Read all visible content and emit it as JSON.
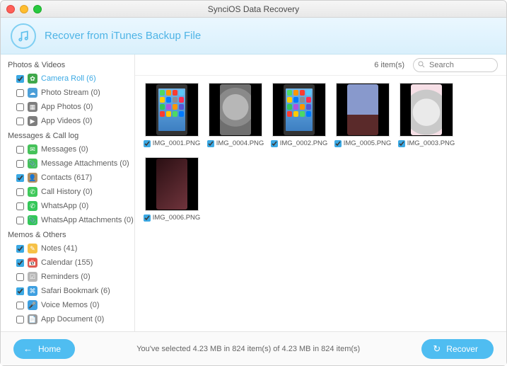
{
  "window": {
    "title": "SynciOS Data Recovery"
  },
  "header": {
    "title": "Recover from iTunes Backup File"
  },
  "sidebar": {
    "groups": [
      {
        "title": "Photos & Videos",
        "items": [
          {
            "label": "Camera Roll (6)",
            "checked": true,
            "selected": true,
            "color": "#3fa74a",
            "glyph": "✿"
          },
          {
            "label": "Photo Stream (0)",
            "checked": false,
            "color": "#4c9fd8",
            "glyph": "☁"
          },
          {
            "label": "App Photos (0)",
            "checked": false,
            "color": "#7e7e7e",
            "glyph": "▦"
          },
          {
            "label": "App Videos (0)",
            "checked": false,
            "color": "#7e7e7e",
            "glyph": "▶"
          }
        ]
      },
      {
        "title": "Messages & Call log",
        "items": [
          {
            "label": "Messages (0)",
            "checked": false,
            "color": "#46c25a",
            "glyph": "✉"
          },
          {
            "label": "Message Attachments (0)",
            "checked": false,
            "color": "#46c25a",
            "glyph": "📎"
          },
          {
            "label": "Contacts (617)",
            "checked": true,
            "color": "#b59060",
            "glyph": "👤"
          },
          {
            "label": "Call History (0)",
            "checked": false,
            "color": "#3fc95a",
            "glyph": "✆"
          },
          {
            "label": "WhatsApp (0)",
            "checked": false,
            "color": "#34c759",
            "glyph": "✆"
          },
          {
            "label": "WhatsApp Attachments (0)",
            "checked": false,
            "color": "#34c759",
            "glyph": "📎"
          }
        ]
      },
      {
        "title": "Memos & Others",
        "items": [
          {
            "label": "Notes (41)",
            "checked": true,
            "color": "#f6c147",
            "glyph": "✎"
          },
          {
            "label": "Calendar (155)",
            "checked": true,
            "color": "#e05b52",
            "glyph": "📅"
          },
          {
            "label": "Reminders (0)",
            "checked": false,
            "color": "#b7b7b7",
            "glyph": "☑"
          },
          {
            "label": "Safari Bookmark (6)",
            "checked": true,
            "color": "#3e9fe0",
            "glyph": "⌘"
          },
          {
            "label": "Voice Memos (0)",
            "checked": false,
            "color": "#3e9fe0",
            "glyph": "🎤"
          },
          {
            "label": "App Document (0)",
            "checked": false,
            "color": "#9b9b9b",
            "glyph": "📄"
          }
        ]
      }
    ]
  },
  "toolbar": {
    "count_label": "6 item(s)",
    "search_placeholder": "Search"
  },
  "items": [
    {
      "filename": "IMG_0001.PNG",
      "checked": true,
      "kind": "phone-blue"
    },
    {
      "filename": "IMG_0004.PNG",
      "checked": true,
      "kind": "koala"
    },
    {
      "filename": "IMG_0002.PNG",
      "checked": true,
      "kind": "phone-blue"
    },
    {
      "filename": "IMG_0005.PNG",
      "checked": true,
      "kind": "city"
    },
    {
      "filename": "IMG_0003.PNG",
      "checked": true,
      "kind": "totoro"
    },
    {
      "filename": "IMG_0006.PNG",
      "checked": true,
      "kind": "dark"
    }
  ],
  "footer": {
    "home_label": "Home",
    "recover_label": "Recover",
    "status": "You've selected 4.23 MB in 824 item(s) of 4.23 MB in 824 item(s)"
  },
  "palette": {
    "accent": "#4fbdf1"
  }
}
